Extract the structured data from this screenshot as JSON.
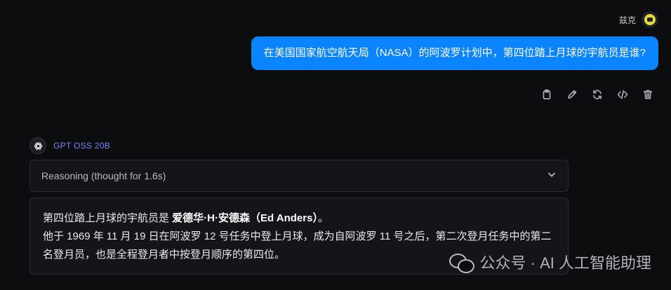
{
  "user": {
    "name": "兹克"
  },
  "user_message": "在美国国家航空航天局（NASA）的阿波罗计划中，第四位踏上月球的宇航员是谁?",
  "message_actions": [
    "clipboard-icon",
    "pencil-icon",
    "refresh-icon",
    "code-icon",
    "trash-icon"
  ],
  "bot": {
    "name": "GPT OSS 20B"
  },
  "reasoning": {
    "label": "Reasoning (thought for 1.6s)"
  },
  "answer": {
    "line1_prefix": "第四位踏上月球的宇航员是 ",
    "line1_bold": "爱德华·H·安德森（Ed Anders）",
    "line1_suffix": "。",
    "line2": "他于 1969 年 11 月 19 日在阿波罗 12 号任务中登上月球，成为自阿波罗 11 号之后，第二次登月任务中的第二名登月员，也是全程登月者中按登月顺序的第四位。"
  },
  "watermark": {
    "text": "公众号 · AI 人工智能助理"
  },
  "colors": {
    "accent": "#0a84ff",
    "bot_name": "#7c82ff",
    "background": "#0c0d0f"
  }
}
